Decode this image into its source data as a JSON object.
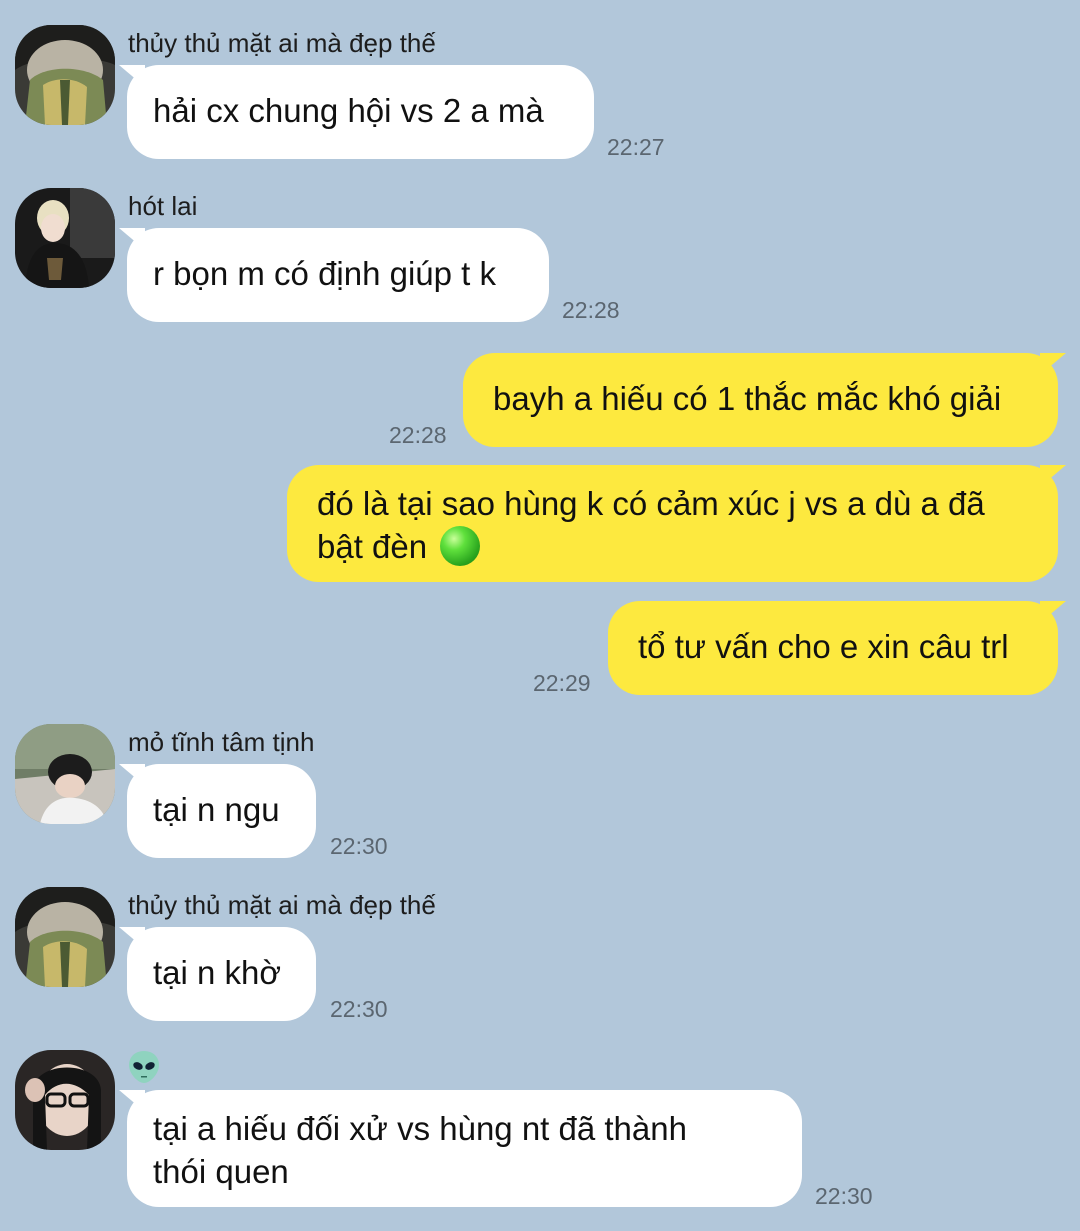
{
  "chat": {
    "messages": [
      {
        "id": 1,
        "direction": "in",
        "sender": "thủy thủ mặt ai mà đẹp thế",
        "text": "hải cx chung hội vs 2 a mà",
        "time": "22:27"
      },
      {
        "id": 2,
        "direction": "in",
        "sender": "hót lai",
        "text": "r bọn m có định giúp t k",
        "time": "22:28"
      },
      {
        "id": 3,
        "direction": "out",
        "text": "bayh a hiếu có 1 thắc mắc khó giải",
        "time": "22:28"
      },
      {
        "id": 4,
        "direction": "out",
        "text_line1": "đó là tại sao hùng k có cảm xúc j vs a dù a đã",
        "text_line2": "bật đèn",
        "emoji": "green-circle-emoji"
      },
      {
        "id": 5,
        "direction": "out",
        "text": "tổ tư vấn cho e xin câu trl",
        "time": "22:29"
      },
      {
        "id": 6,
        "direction": "in",
        "sender": "mỏ tĩnh tâm tịnh",
        "text": "tại n ngu",
        "time": "22:30"
      },
      {
        "id": 7,
        "direction": "in",
        "sender": "thủy thủ mặt ai mà đẹp thế",
        "text": "tại n khờ",
        "time": "22:30"
      },
      {
        "id": 8,
        "direction": "in",
        "sender_icon": "alien-emoji",
        "text_line1": "tại a hiếu đối xử vs hùng nt đã thành",
        "text_line2": "thói quen",
        "time": "22:30"
      }
    ]
  },
  "colors": {
    "background": "#b2c7da",
    "incoming_bubble": "#ffffff",
    "outgoing_bubble": "#fde93f",
    "timestamp": "#5b6670"
  }
}
